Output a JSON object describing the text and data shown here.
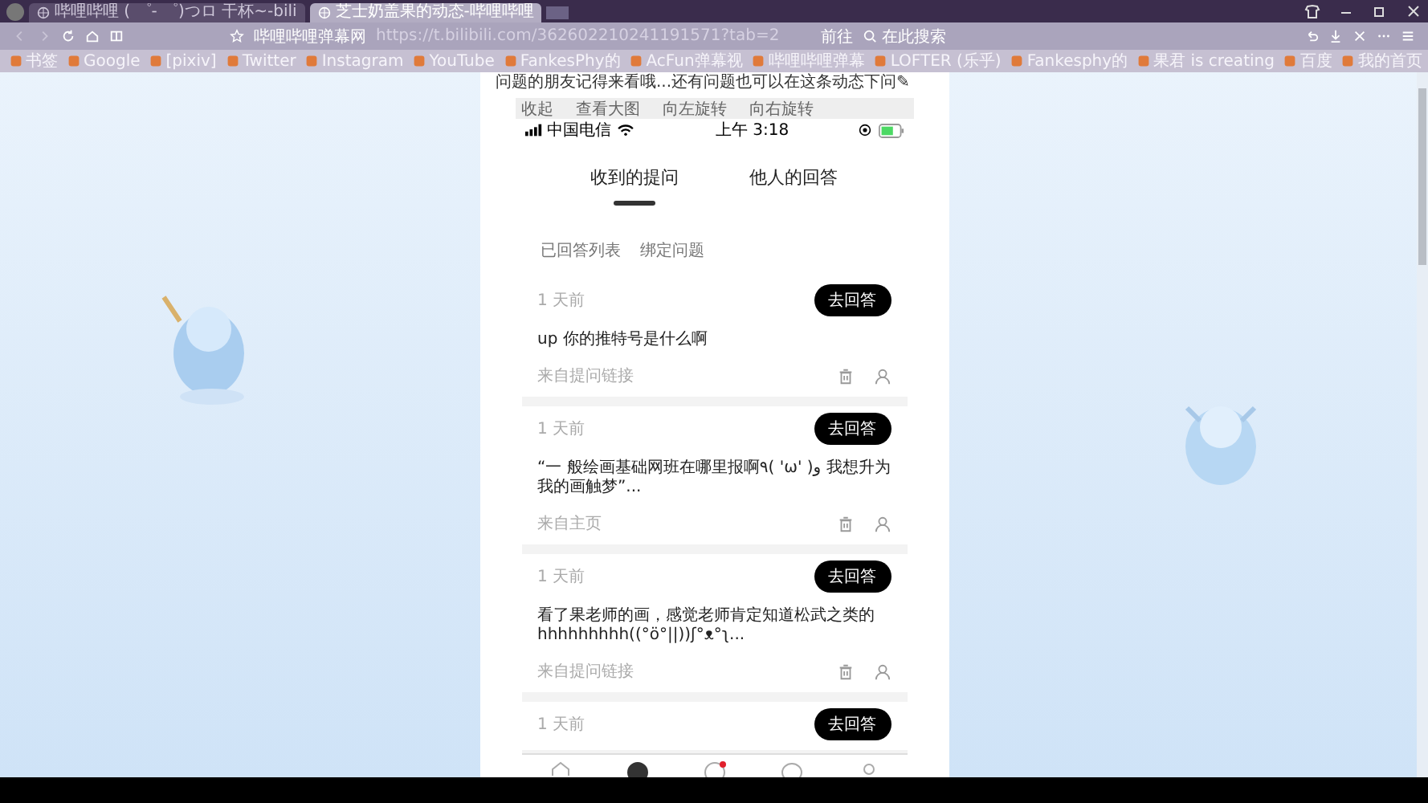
{
  "browser": {
    "tabs": [
      {
        "title": "哔哩哔哩 ( ゜- ゜)つロ 干杯~-bili",
        "selected": false
      },
      {
        "title": "芝士奶盖果的动态-哔哩哔哩",
        "selected": true
      }
    ],
    "address": {
      "site": "哔哩哔哩弹幕网",
      "url": "https://t.bilibili.com/362602210241191571?tab=2"
    },
    "go_label": "前往",
    "search_placeholder": "在此搜索",
    "bookmarks": [
      "书签",
      "Google",
      "[pixiv]",
      "Twitter",
      "Instagram",
      "YouTube",
      "FankesPhy的",
      "AcFun弹幕视",
      "哔哩哔哩弹幕",
      "LOFTER (乐乎)",
      "Fankesphy的",
      "果君 is creating",
      "百度",
      "我的首页"
    ]
  },
  "post": {
    "note": "问题的朋友记得来看哦...还有问题也可以在这条动态下问✎",
    "viewer_tools": [
      "收起",
      "查看大图",
      "向左旋转",
      "向右旋转"
    ],
    "phone": {
      "carrier": "中国电信",
      "time": "上午 3:18",
      "tabs": [
        {
          "label": "收到的提问",
          "selected": true
        },
        {
          "label": "他人的回答",
          "selected": false
        }
      ],
      "subtabs": [
        "已回答列表",
        "绑定问题"
      ],
      "cards": [
        {
          "time": "1 天前",
          "button": "去回答",
          "question": "up  你的推特号是什么啊",
          "source": "来自提问链接"
        },
        {
          "time": "1 天前",
          "button": "去回答",
          "question": "“一 般绘画基础网班在哪里报啊٩( 'ω' )و 我想升为我的画触梦”...",
          "source": "来自主页"
        },
        {
          "time": "1 天前",
          "button": "去回答",
          "question": "看了果老师的画，感觉老师肯定知道松武之类的hhhhhhhhh((°ö°||))ʃ°ᴥ°ʅ...",
          "source": "来自提问链接"
        },
        {
          "time": "1 天前",
          "button": "去回答"
        }
      ],
      "nav": [
        {
          "kind": "home",
          "selected": false,
          "badge": false
        },
        {
          "kind": "disc",
          "selected": true,
          "badge": false
        },
        {
          "kind": "face",
          "selected": false,
          "badge": true
        },
        {
          "kind": "chat",
          "selected": false,
          "badge": false
        },
        {
          "kind": "person",
          "selected": false,
          "badge": false
        }
      ]
    }
  }
}
